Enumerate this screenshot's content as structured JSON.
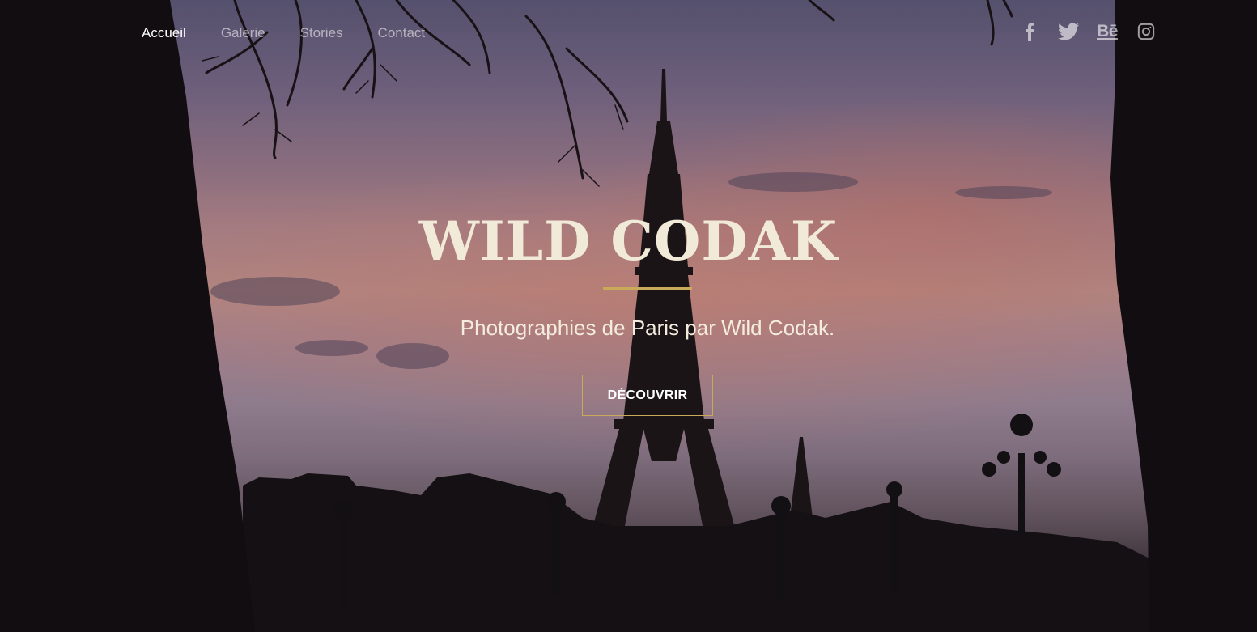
{
  "nav": {
    "items": [
      {
        "label": "Accueil",
        "active": true
      },
      {
        "label": "Galerie",
        "active": false
      },
      {
        "label": "Stories",
        "active": false
      },
      {
        "label": "Contact",
        "active": false
      }
    ]
  },
  "social": {
    "facebook_icon": "facebook-icon",
    "twitter_icon": "twitter-icon",
    "behance_label": "Bē",
    "instagram_icon": "instagram-icon"
  },
  "hero": {
    "title": "WILD CODAK",
    "subtitle": "Photographies de Paris par Wild Codak.",
    "cta_label": "DÉCOUVRIR",
    "background_image": "paris-eiffel-tower-sunset-silhouette"
  },
  "colors": {
    "accent": "#c9a95a",
    "title": "#f1ead8",
    "nav_active": "#ffffff",
    "nav_inactive": "rgba(255,255,255,0.55)"
  }
}
